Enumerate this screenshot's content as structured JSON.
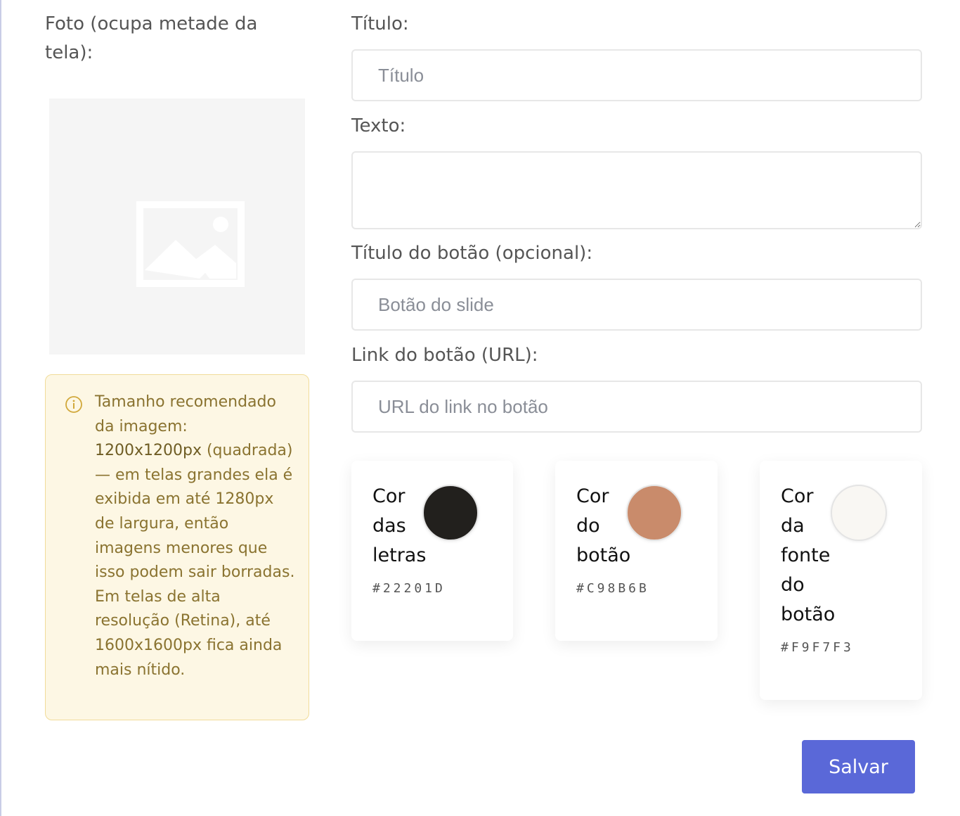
{
  "photo": {
    "label": "Foto (ocupa metade da tela):",
    "placeholder_icon": "image-placeholder-icon"
  },
  "notice": {
    "icon": "info-icon",
    "text_before": "Tamanho recomendado da imagem: ",
    "text_highlight": "1200x1200px",
    "text_after": " (quadrada) — em telas grandes ela é exibida em até 1280px de largura, então imagens menores que isso podem sair borradas. Em telas de alta resolução (Retina), até 1600x1600px fica ainda mais nítido."
  },
  "form": {
    "title_label": "Título:",
    "title_placeholder": "Título",
    "text_label": "Texto:",
    "button_title_label": "Título do botão (opcional):",
    "button_title_placeholder": "Botão do slide",
    "button_link_label": "Link do botão (URL):",
    "button_link_placeholder": "URL do link no botão"
  },
  "colors": [
    {
      "label": "Cor das letras",
      "hex": "#22201D",
      "value": "#22201D"
    },
    {
      "label": "Cor do botão",
      "hex": "#C98B6B",
      "value": "#C98B6B"
    },
    {
      "label": "Cor da fonte do botão",
      "hex": "#F9F7F3",
      "value": "#F9F7F3"
    }
  ],
  "actions": {
    "save_label": "Salvar"
  },
  "theme": {
    "accent": "#5A68D8",
    "notice_bg": "#FDF7E4",
    "notice_border": "#F1DC9A",
    "notice_text": "#8A7330"
  }
}
